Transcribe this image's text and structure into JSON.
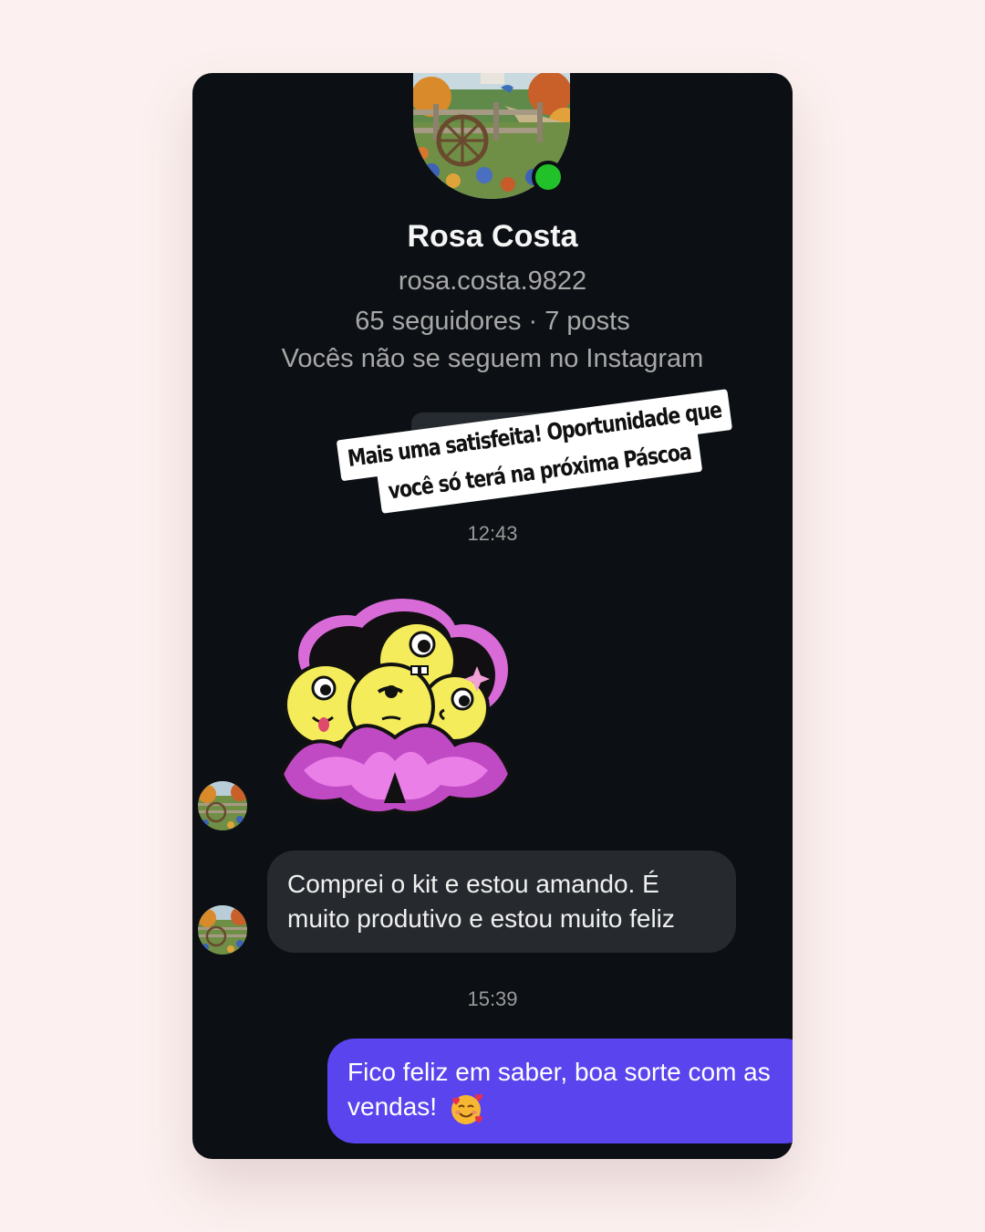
{
  "profile": {
    "name": "Rosa Costa",
    "username": "rosa.costa.9822",
    "stats": "65 seguidores · 7 posts",
    "follow_note": "Vocês não se seguem no Instagram",
    "online": true
  },
  "story_caption": {
    "line1": "Mais uma satisfeita! Oportunidade que",
    "line2": "você só terá na próxima Páscoa"
  },
  "timestamps": [
    "12:43",
    "15:39"
  ],
  "messages": [
    {
      "from": "Rosa Costa",
      "type": "sticker",
      "sticker": "flower-blob-faces"
    },
    {
      "from": "Rosa Costa",
      "type": "text",
      "text": "Comprei o kit e estou amando. É muito produtivo e estou muito feliz"
    },
    {
      "from": "me",
      "type": "text",
      "text": "Fico feliz em saber, boa sorte com as vendas!",
      "emoji": "smiling-face-with-hearts-icon"
    }
  ],
  "colors": {
    "page_background": "#fcf1f0",
    "chat_background": "#0c1014",
    "incoming_bubble": "#262a2f",
    "outgoing_bubble": "#5a44ee",
    "online_indicator": "#21c129",
    "secondary_text": "#a8a8a8"
  }
}
